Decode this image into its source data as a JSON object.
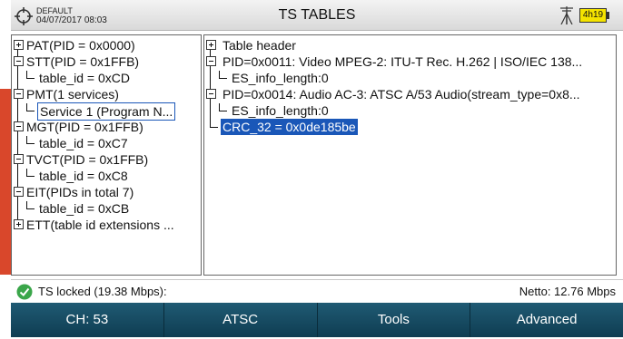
{
  "header": {
    "profile": "DEFAULT",
    "datetime": "04/07/2017 08:03",
    "title": "TS TABLES",
    "battery": "4h19",
    "accent_color": "#f4e300"
  },
  "left_tree": {
    "nodes": [
      {
        "label": "PAT(PID = 0x0000)",
        "expander": "plus"
      },
      {
        "label": "STT(PID = 0x1FFB)",
        "expander": "minus"
      },
      {
        "label": "table_id = 0xCD",
        "expander": "none"
      },
      {
        "label": "PMT(1 services)",
        "expander": "minus"
      },
      {
        "label": "Service 1 (Program N...",
        "expander": "none",
        "selected": true
      },
      {
        "label": "MGT(PID = 0x1FFB)",
        "expander": "minus"
      },
      {
        "label": "table_id = 0xC7",
        "expander": "none"
      },
      {
        "label": "TVCT(PID = 0x1FFB)",
        "expander": "minus"
      },
      {
        "label": "table_id = 0xC8",
        "expander": "none"
      },
      {
        "label": "EIT(PIDs in total 7)",
        "expander": "minus"
      },
      {
        "label": "table_id = 0xCB",
        "expander": "none"
      },
      {
        "label": "ETT(table id extensions ...",
        "expander": "plus"
      }
    ]
  },
  "right_tree": {
    "nodes": [
      {
        "label": "Table header",
        "expander": "plus"
      },
      {
        "label": "PID=0x0011: Video MPEG-2: ITU-T Rec. H.262 | ISO/IEC 138...",
        "expander": "minus"
      },
      {
        "label": "ES_info_length:0",
        "expander": "none"
      },
      {
        "label": "PID=0x0014: Audio AC-3: ATSC A/53 Audio(stream_type=0x8...",
        "expander": "minus"
      },
      {
        "label": "ES_info_length:0",
        "expander": "none"
      },
      {
        "label": "CRC_32 = 0x0de185be",
        "expander": "none",
        "selected": true
      }
    ]
  },
  "status": {
    "left_text": "TS locked (19.38 Mbps):",
    "right_text": "Netto: 12.76 Mbps",
    "ok_color": "#3aa64a"
  },
  "softkeys": [
    "CH: 53",
    "ATSC",
    "Tools",
    "Advanced"
  ]
}
